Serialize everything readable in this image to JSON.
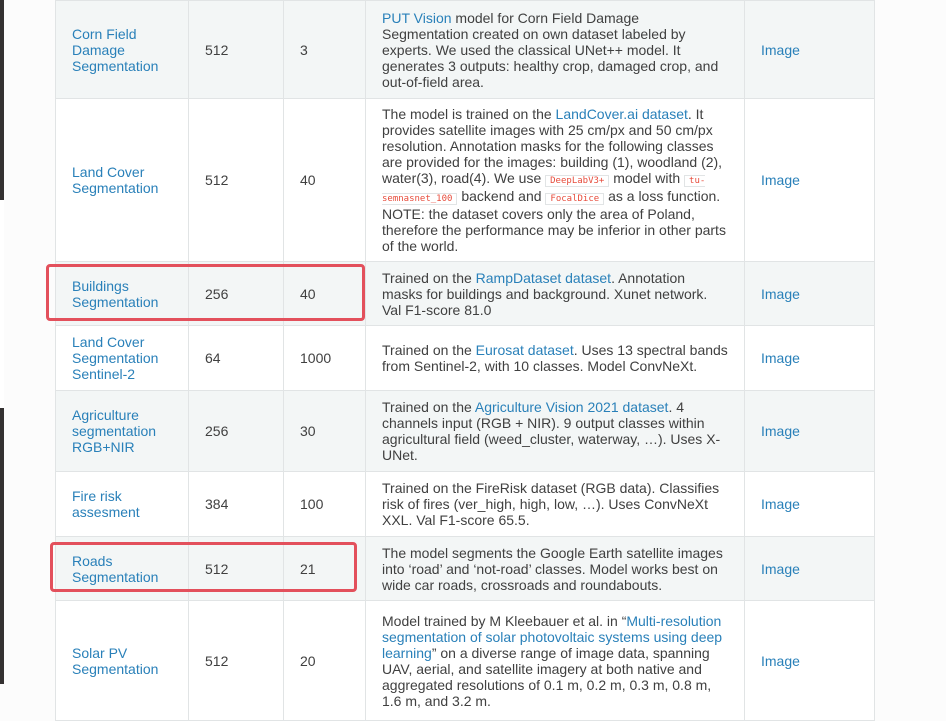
{
  "rows": [
    {
      "name": "Corn Field Damage Segmentation",
      "size": "512",
      "epochs": "3",
      "desc": [
        {
          "t": "PUT Vision",
          "link": true
        },
        {
          "t": " model for Corn Field Damage Segmentation created on own dataset labeled by experts. We used the classical UNet++ model. It generates 3 outputs: healthy crop, damaged crop, and out-of-field area."
        }
      ],
      "image": "Image"
    },
    {
      "name": "Land Cover Segmentation",
      "size": "512",
      "epochs": "40",
      "desc": [
        {
          "t": "The model is trained on the "
        },
        {
          "t": "LandCover.ai dataset",
          "link": true
        },
        {
          "t": ". It provides satellite images with 25 cm/px and 50 cm/px resolution. Annotation masks for the following classes are provided for the images: building (1), woodland (2), water(3), road(4). We use "
        },
        {
          "t": "DeepLabV3+",
          "code": true
        },
        {
          "t": " model with "
        },
        {
          "t": "tu-semnasnet_100",
          "code": true
        },
        {
          "t": " backend and "
        },
        {
          "t": "FocalDice",
          "code": true
        },
        {
          "t": " as a loss function. NOTE: the dataset covers only the area of Poland, therefore the performance may be inferior in other parts of the world."
        }
      ],
      "image": "Image"
    },
    {
      "name": "Buildings Segmentation",
      "size": "256",
      "epochs": "40",
      "desc": [
        {
          "t": "Trained on the "
        },
        {
          "t": "RampDataset dataset",
          "link": true
        },
        {
          "t": ". Annotation masks for buildings and background. Xunet network. Val F1-score 81.0"
        }
      ],
      "image": "Image"
    },
    {
      "name": "Land Cover Segmentation Sentinel-2",
      "size": "64",
      "epochs": "1000",
      "desc": [
        {
          "t": "Trained on the "
        },
        {
          "t": "Eurosat dataset",
          "link": true
        },
        {
          "t": ". Uses 13 spectral bands from Sentinel-2, with 10 classes. Model ConvNeXt."
        }
      ],
      "image": "Image"
    },
    {
      "name": "Agriculture segmentation RGB+NIR",
      "size": "256",
      "epochs": "30",
      "desc": [
        {
          "t": "Trained on the "
        },
        {
          "t": "Agriculture Vision 2021 dataset",
          "link": true
        },
        {
          "t": ". 4 channels input (RGB + NIR). 9 output classes within agricultural field (weed_cluster, waterway, …). Uses X-UNet."
        }
      ],
      "image": "Image"
    },
    {
      "name": "Fire risk assesment",
      "size": "384",
      "epochs": "100",
      "desc": [
        {
          "t": "Trained on the FireRisk dataset (RGB data). Classifies risk of fires (ver_high, high, low, …). Uses ConvNeXt XXL. Val F1-score 65.5."
        }
      ],
      "image": "Image"
    },
    {
      "name": "Roads Segmentation",
      "size": "512",
      "epochs": "21",
      "desc": [
        {
          "t": "The model segments the Google Earth satellite images into ‘road’ and ‘not-road’ classes. Model works best on wide car roads, crossroads and roundabouts."
        }
      ],
      "image": "Image"
    },
    {
      "name": "Solar PV Segmentation",
      "size": "512",
      "epochs": "20",
      "desc": [
        {
          "t": "Model trained by M Kleebauer et al. in “"
        },
        {
          "t": "Multi-resolution segmentation of solar photovoltaic systems using deep learning",
          "link": true
        },
        {
          "t": "” on a diverse range of image data, spanning UAV, aerial, and satellite imagery at both native and aggregated resolutions of 0.1 m, 0.2 m, 0.3 m, 0.8 m, 1.6 m, and 3.2 m."
        }
      ],
      "image": "Image"
    }
  ],
  "colors": {
    "link": "#2980b9",
    "highlight": "#e3505c",
    "row_odd": "#f3f6f6",
    "row_even": "#ffffff"
  }
}
